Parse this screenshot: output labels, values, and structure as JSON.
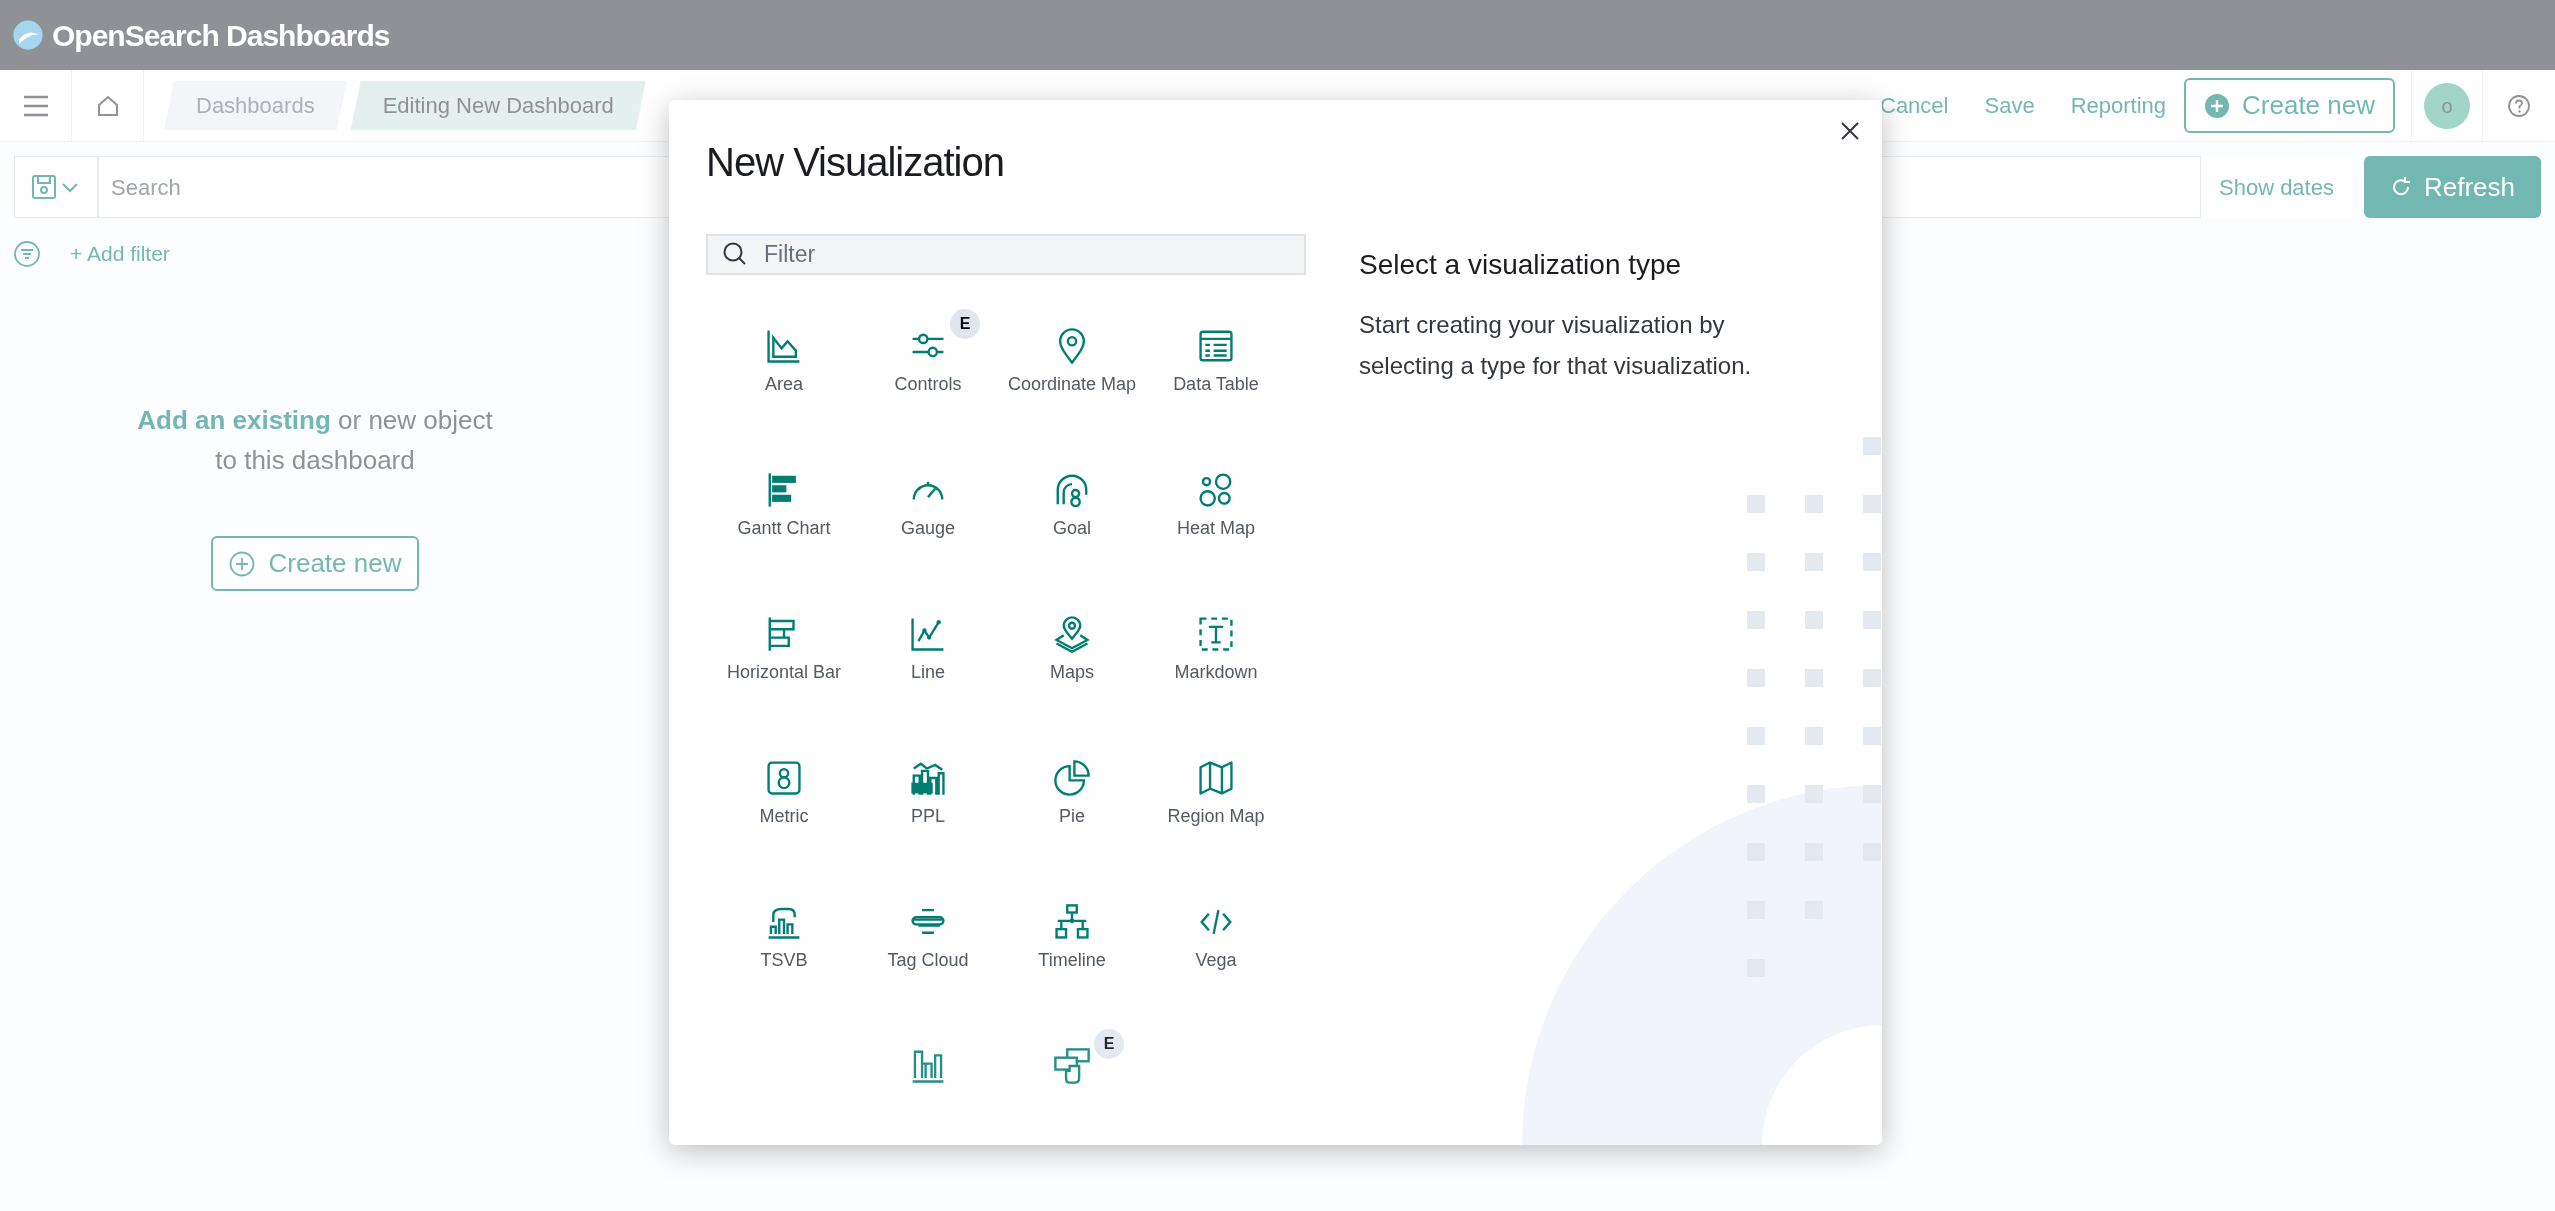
{
  "header": {
    "brand": "OpenSearch Dashboards"
  },
  "breadcrumbs": [
    {
      "label": "Dashboards",
      "selected": false
    },
    {
      "label": "Editing New Dashboard",
      "selected": true
    }
  ],
  "top_actions": [
    "Cancel",
    "Save",
    "Reporting"
  ],
  "create_button": "Create new",
  "avatar": "o",
  "search": {
    "placeholder": "Search"
  },
  "show_dates": "Show dates",
  "refresh_button": "Refresh",
  "add_filter": "+ Add filter",
  "empty_prompt": {
    "text": "**Add an existing** or new object to this dashboard",
    "button": "Create new"
  },
  "modal": {
    "title": "New Visualization",
    "filter": {
      "placeholder": "Filter"
    },
    "items": [
      {
        "label": "Area"
      },
      {
        "label": "Controls",
        "badge": "E"
      },
      {
        "label": "Coordinate Map"
      },
      {
        "label": "Data Table"
      },
      {
        "label": "Gantt Chart"
      },
      {
        "label": "Gauge"
      },
      {
        "label": "Goal"
      },
      {
        "label": "Heat Map"
      },
      {
        "label": "Horizontal Bar"
      },
      {
        "label": "Line"
      },
      {
        "label": "Maps"
      },
      {
        "label": "Markdown"
      },
      {
        "label": "Metric"
      },
      {
        "label": "PPL"
      },
      {
        "label": "Pie"
      },
      {
        "label": "Region Map"
      },
      {
        "label": "TSVB"
      },
      {
        "label": "Tag Cloud"
      },
      {
        "label": "Timeline"
      },
      {
        "label": "Vega"
      },
      {
        "kind": "cut"
      },
      {
        "kind": "cut",
        "badge": "E"
      }
    ],
    "side_title": "Select a visualization type",
    "side_text": "Start creating your visualization by selecting a type for that visualization."
  }
}
